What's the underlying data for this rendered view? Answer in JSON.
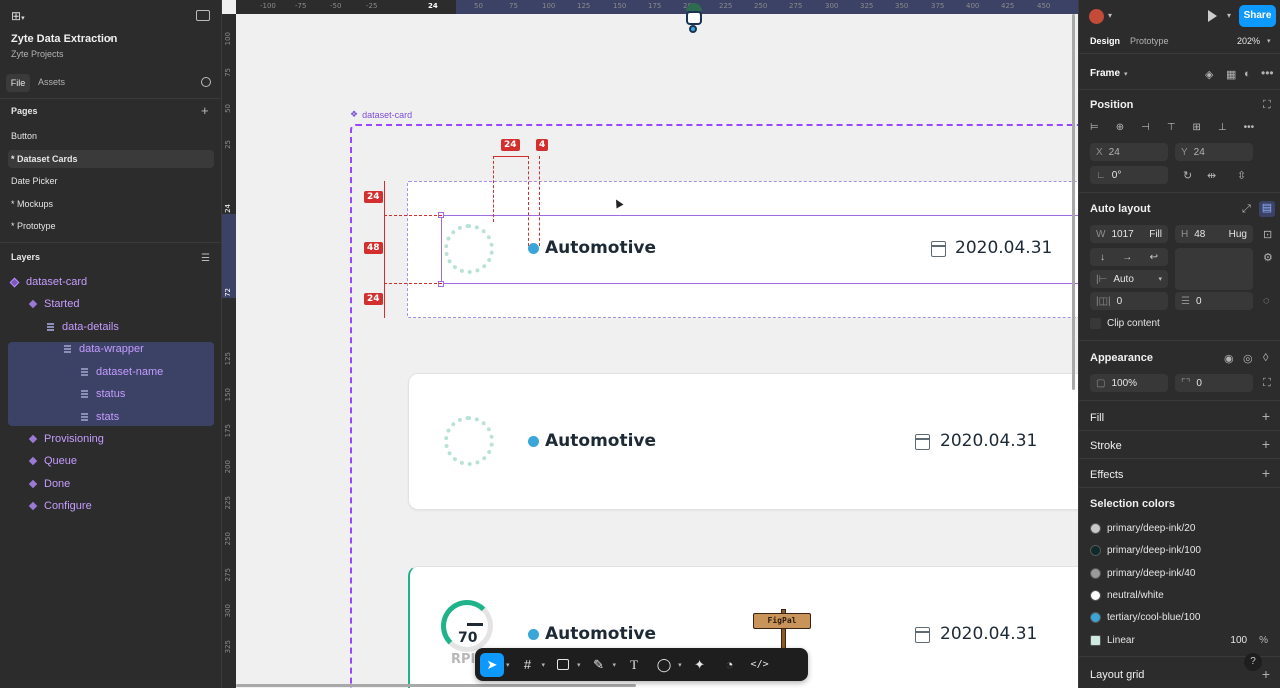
{
  "app": {
    "file_name": "Zyte Data Extraction",
    "project": "Zyte Projects",
    "tabs": [
      "File",
      "Assets"
    ]
  },
  "pages": {
    "title": "Pages",
    "items": [
      "Button",
      "* Dataset Cards",
      "Date Picker",
      "* Mockups",
      "* Prototype"
    ]
  },
  "layers": {
    "title": "Layers",
    "items": [
      "dataset-card",
      "Started",
      "data-details",
      "data-wrapper",
      "dataset-name",
      "status",
      "stats",
      "Provisioning",
      "Queue",
      "Done",
      "Configure"
    ]
  },
  "canvas": {
    "ruler_x": [
      "-100",
      "-75",
      "-50",
      "-25",
      "24",
      "50",
      "75",
      "100",
      "125",
      "150",
      "175",
      "200",
      "225",
      "250",
      "275",
      "300",
      "325",
      "350",
      "375",
      "400",
      "425",
      "450"
    ],
    "ruler_y": [
      "100",
      "75",
      "50",
      "25",
      "24",
      "72",
      "125",
      "150",
      "175",
      "200",
      "225",
      "250",
      "275",
      "300",
      "325"
    ],
    "frame_label": "dataset-card",
    "measures": [
      "24",
      "4",
      "24",
      "48",
      "24"
    ],
    "cards": [
      {
        "name": "Automotive",
        "date": "2020.04.31"
      },
      {
        "name": "Automotive",
        "date": "2020.04.31"
      },
      {
        "name": "Automotive",
        "date": "2020.04.31",
        "gauge_value": "70",
        "gauge_unit": "RPI"
      }
    ],
    "figpal_label": "FigPal"
  },
  "right": {
    "share": "Share",
    "tabs": [
      "Design",
      "Prototype"
    ],
    "zoom": "202%",
    "frame": "Frame",
    "position": {
      "title": "Position",
      "x": "24",
      "y": "24",
      "rotation": "0°"
    },
    "auto_layout": {
      "title": "Auto layout",
      "w": "1017",
      "w_mode": "Fill",
      "h": "48",
      "h_mode": "Hug",
      "gap": "Auto",
      "pad_h": "0",
      "pad_v": "0",
      "clip": "Clip content"
    },
    "appearance": {
      "title": "Appearance",
      "opacity": "100%",
      "radius": "0"
    },
    "fill": "Fill",
    "stroke": "Stroke",
    "effects": "Effects",
    "selection_colors": {
      "title": "Selection colors",
      "items": [
        {
          "name": "primary/deep-ink/20",
          "color": "#c8c8c8"
        },
        {
          "name": "primary/deep-ink/100",
          "color": "#0f2a2a"
        },
        {
          "name": "primary/deep-ink/40",
          "color": "#9a9a9a"
        },
        {
          "name": "neutral/white",
          "color": "#ffffff"
        },
        {
          "name": "tertiary/cool-blue/100",
          "color": "#3aa5d8"
        },
        {
          "name": "Linear",
          "color": "#cfe9e0",
          "opacity": "100",
          "unit": "%"
        }
      ]
    },
    "layout_grid": "Layout grid"
  },
  "colors": {
    "accent": "#0d99ff",
    "component": "#9747ff",
    "measure": "#d32f2f"
  }
}
